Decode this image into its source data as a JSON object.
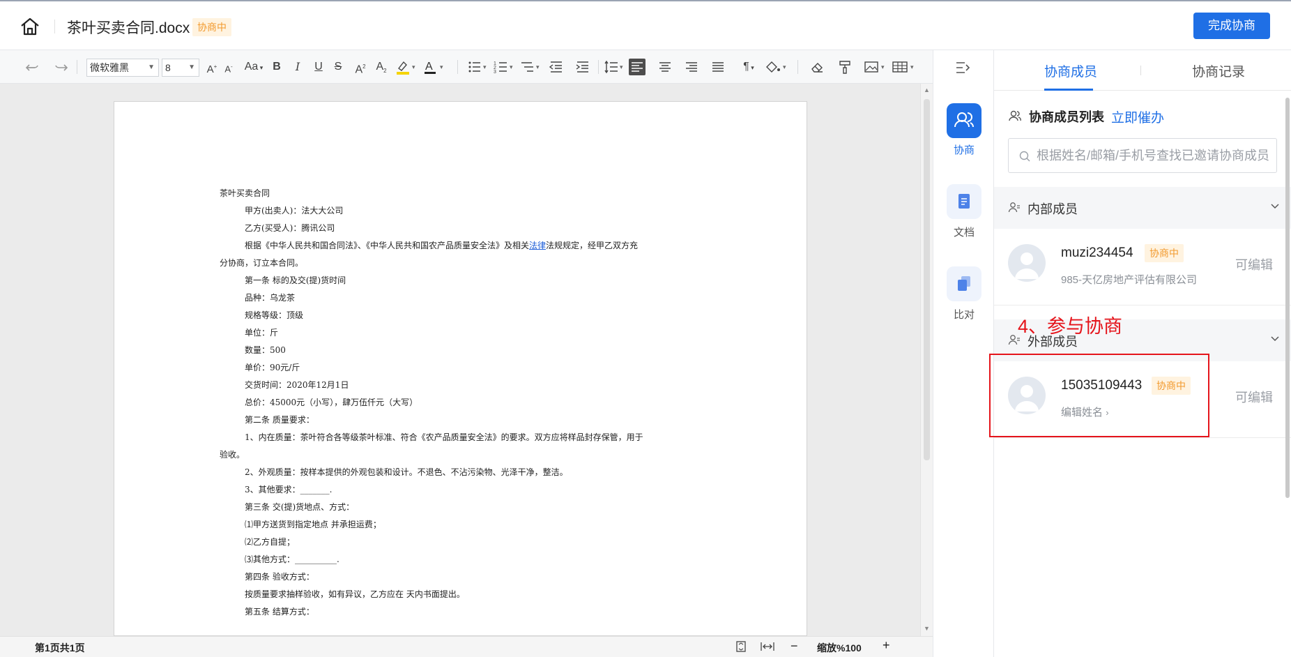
{
  "header": {
    "doc_title": "茶叶买卖合同.docx",
    "status_badge": "协商中",
    "finish_button": "完成协商"
  },
  "toolbar": {
    "font_name": "微软雅黑",
    "font_size": "8",
    "font_case": "Aa"
  },
  "document": {
    "lines": [
      "茶叶买卖合同",
      "甲方(出卖人)：法大大公司",
      "乙方(买受人)：腾讯公司",
      "根据《中华人民共和国合同法》、《中华人民共和国农产品质量安全法》及相关",
      "法律",
      "法规规定，经甲乙双方充",
      "分协商，订立本合同。",
      "第一条 标的及交(提)货时间",
      "品种：乌龙茶",
      "规格等级：顶级",
      "单位：斤",
      "数量：500",
      "单价：90元/斤",
      "交货时间：2020年12月1日",
      "总价：45000元（小写），肆万伍仟元（大写）",
      "第二条 质量要求：",
      "1、内在质量：茶叶符合各等级茶叶标准、符合《农产品质量安全法》的要求。双方应将样品封存保管，用于",
      "验收。",
      "2、外观质量：按样本提供的外观包装和设计。不退色、不沾污染物、光泽干净，整洁。",
      "3、其他要求：_______.",
      "第三条 交(提)货地点、方式：",
      "⑴甲方送货到指定地点 并承担运费；",
      "⑵乙方自提；",
      "⑶其他方式：__________.",
      "第四条 验收方式：",
      "按质量要求抽样验收，如有异议，乙方应在 天内书面提出。",
      "第五条 结算方式："
    ]
  },
  "statusbar": {
    "page_info": "第1页共1页",
    "zoom": "缩放%100"
  },
  "rail": {
    "negotiate": "协商",
    "document": "文档",
    "compare": "比对"
  },
  "panel": {
    "tab_members": "协商成员",
    "tab_records": "协商记录",
    "list_title": "协商成员列表",
    "urge_link": "立即催办",
    "search_placeholder": "根据姓名/邮箱/手机号查找已邀请协商成员",
    "internal_title": "内部成员",
    "external_title": "外部成员",
    "internal_members": [
      {
        "name": "muzi234454",
        "badge": "协商中",
        "sub": "985-天亿房地产评估有限公司",
        "permission": "可编辑"
      }
    ],
    "external_members": [
      {
        "name": "15035109443",
        "badge": "协商中",
        "sub": "编辑姓名",
        "permission": "可编辑"
      }
    ]
  },
  "annotation": {
    "text": "4、参与协商"
  },
  "colors": {
    "accent": "#1f6fe5",
    "badge_bg": "#fff3e0",
    "badge_text": "#f29a2e",
    "annotation": "#e5141b"
  }
}
